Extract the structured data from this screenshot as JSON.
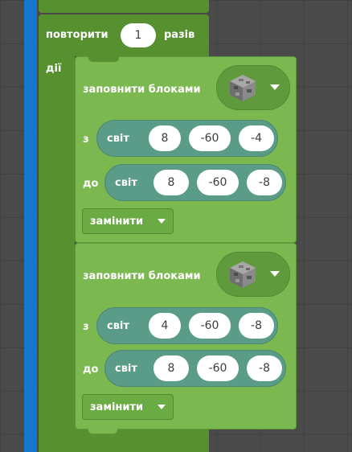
{
  "repeat": {
    "prefix": "повторити",
    "times": "1",
    "suffix": "разів",
    "do_label": "дії"
  },
  "blocks": [
    {
      "title": "заповнити блоками",
      "block_icon": "cobblestone-icon",
      "from_label": "з",
      "from_type": "світ",
      "from": [
        "8",
        "-60",
        "-4"
      ],
      "to_label": "до",
      "to_type": "світ",
      "to": [
        "8",
        "-60",
        "-8"
      ],
      "mode": "замінити"
    },
    {
      "title": "заповнити блоками",
      "block_icon": "cobblestone-icon",
      "from_label": "з",
      "from_type": "світ",
      "from": [
        "4",
        "-60",
        "-8"
      ],
      "to_label": "до",
      "to_type": "світ",
      "to": [
        "8",
        "-60",
        "-8"
      ],
      "mode": "замінити"
    }
  ],
  "colors": {
    "loop": "#56902f",
    "blocks": "#7bb950",
    "position": "#5a9c88",
    "rail": "#1677cf"
  }
}
